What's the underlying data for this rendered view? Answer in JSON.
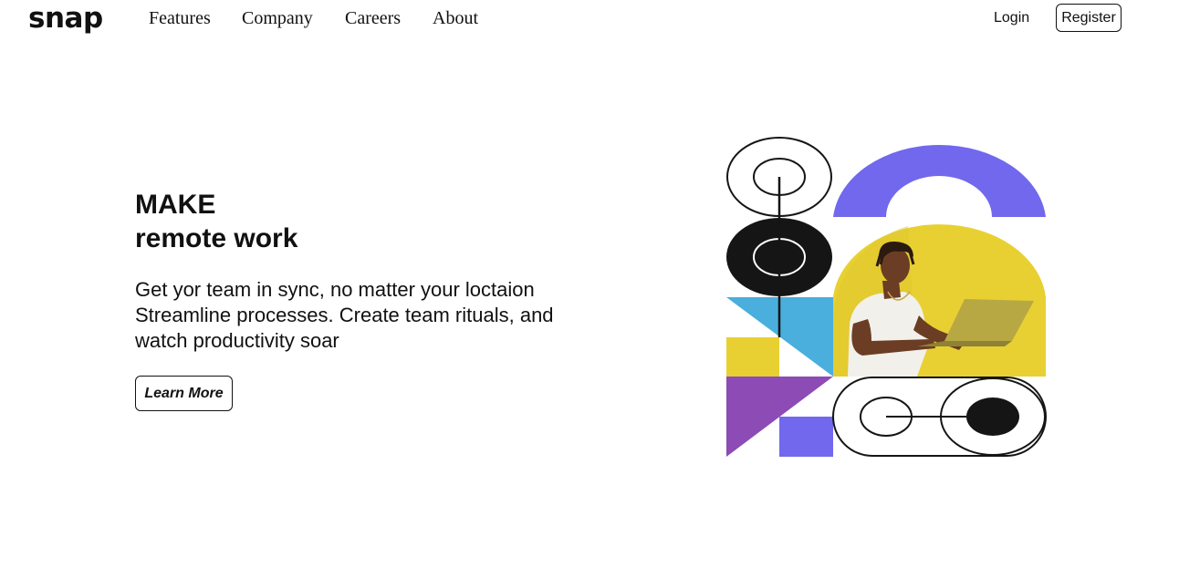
{
  "header": {
    "logo": "snap",
    "nav": {
      "features": "Features",
      "company": "Company",
      "careers": "Careers",
      "about": "About"
    },
    "login_label": "Login",
    "register_label": "Register"
  },
  "hero": {
    "title_line1": "MAKE",
    "title_line2": "remote work",
    "text_line1": "Get yor team in sync, no matter your loctaion",
    "text_line2": "Streamline processes. Create team rituals, and",
    "text_line3": "watch productivity soar",
    "cta_label": "Learn More"
  },
  "illustration": {
    "colors": {
      "purple_arch": "#7168ee",
      "yellow": "#e8d032",
      "blue": "#4aafdc",
      "violet": "#8c4bb5",
      "black": "#151515",
      "skin": "#6b3d24",
      "shirt": "#f2f0ea",
      "laptop": "#b8a844"
    }
  }
}
